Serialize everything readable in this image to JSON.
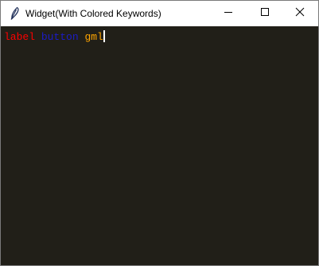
{
  "window": {
    "title": "Widget(With Colored Keywords)",
    "app_icon": "feather-icon",
    "controls": {
      "minimize_icon": "minimize-icon",
      "maximize_icon": "maximize-icon",
      "close_icon": "close-icon"
    }
  },
  "editor": {
    "background": "#211f18",
    "tokens": [
      {
        "text": "label",
        "color": "#ff0000"
      },
      {
        "text": "button",
        "color": "#1c1cc8"
      },
      {
        "text": "gml",
        "color": "#ffa500"
      }
    ]
  }
}
